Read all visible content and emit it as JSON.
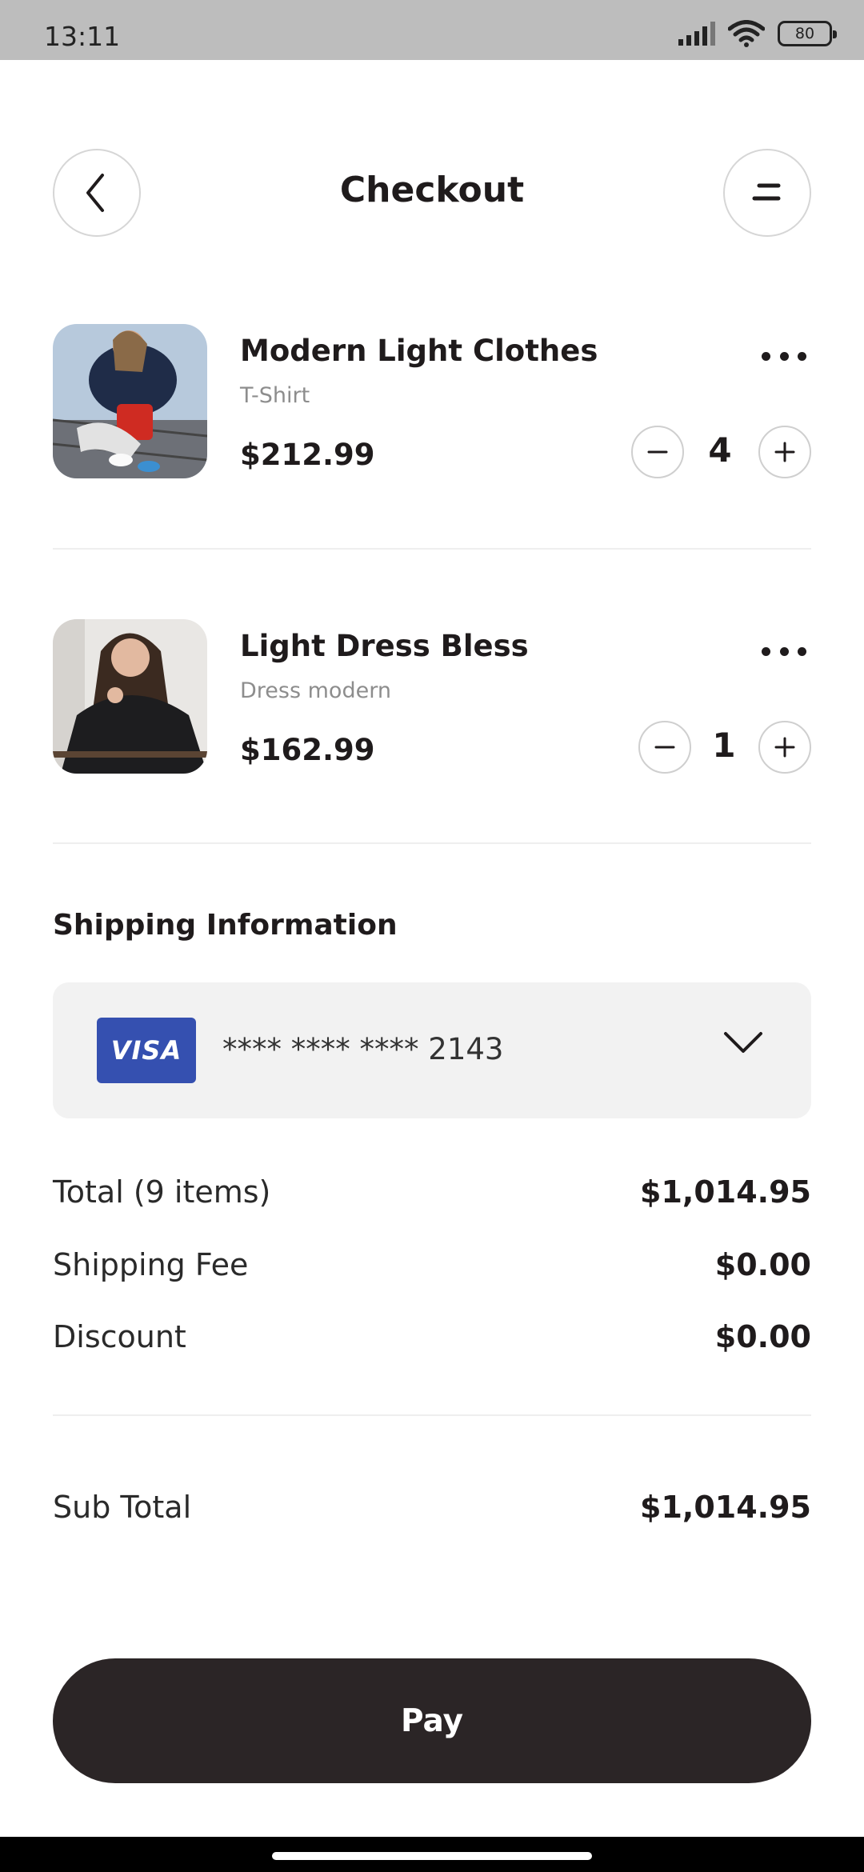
{
  "status_bar": {
    "time": "13:11",
    "battery": "80",
    "icons": [
      "signal-icon",
      "wifi-icon",
      "battery-icon"
    ]
  },
  "header": {
    "title": "Checkout",
    "back_icon": "chevron-left-icon",
    "menu_icon": "menu-icon"
  },
  "cart": {
    "items": [
      {
        "name": "Modern Light Clothes",
        "category": "T-Shirt",
        "price": "$212.99",
        "quantity": "4"
      },
      {
        "name": "Light Dress Bless",
        "category": "Dress modern",
        "price": "$162.99",
        "quantity": "1"
      }
    ]
  },
  "shipping": {
    "title": "Shipping Information",
    "card_brand": "VISA",
    "card_number": "**** **** **** 2143"
  },
  "summary": {
    "rows": [
      {
        "label": "Total (9 items)",
        "value": "$1,014.95"
      },
      {
        "label": "Shipping Fee",
        "value": "$0.00"
      },
      {
        "label": "Discount",
        "value": "$0.00"
      }
    ],
    "subtotal_label": "Sub Total",
    "subtotal_value": "$1,014.95"
  },
  "pay_button": {
    "label": "Pay"
  },
  "colors": {
    "primary_dark": "#2b2526",
    "card_bg": "#f2f2f2",
    "visa_blue": "#3550b0",
    "divider": "#eeeeee"
  }
}
